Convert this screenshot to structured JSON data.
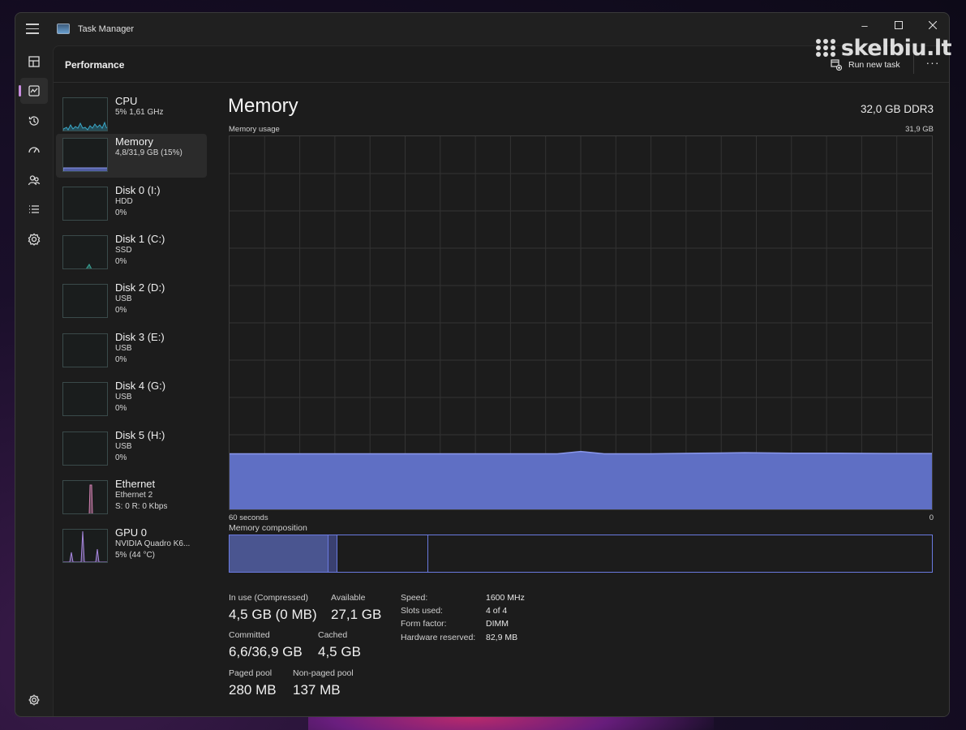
{
  "watermark": "skelbiu.lt",
  "window": {
    "title": "Task Manager"
  },
  "header": {
    "page_title": "Performance",
    "run_new_task": "Run new task",
    "more": "···"
  },
  "nav": [
    {
      "name": "processes",
      "icon": "processes-icon"
    },
    {
      "name": "performance",
      "icon": "performance-icon",
      "active": true
    },
    {
      "name": "app-history",
      "icon": "history-icon"
    },
    {
      "name": "startup-apps",
      "icon": "startup-icon"
    },
    {
      "name": "users",
      "icon": "users-icon"
    },
    {
      "name": "details",
      "icon": "details-icon"
    },
    {
      "name": "services",
      "icon": "services-icon"
    },
    {
      "name": "settings",
      "icon": "gear-icon"
    }
  ],
  "perf_items": [
    {
      "name": "CPU",
      "sub1": "5% 1,61 GHz",
      "sub2": "",
      "kind": "cpu"
    },
    {
      "name": "Memory",
      "sub1": "4,8/31,9 GB (15%)",
      "sub2": "",
      "kind": "memory",
      "selected": true
    },
    {
      "name": "Disk 0 (I:)",
      "sub1": "HDD",
      "sub2": "0%",
      "kind": "disk"
    },
    {
      "name": "Disk 1 (C:)",
      "sub1": "SSD",
      "sub2": "0%",
      "kind": "disk1"
    },
    {
      "name": "Disk 2 (D:)",
      "sub1": "USB",
      "sub2": "0%",
      "kind": "disk"
    },
    {
      "name": "Disk 3 (E:)",
      "sub1": "USB",
      "sub2": "0%",
      "kind": "disk"
    },
    {
      "name": "Disk 4 (G:)",
      "sub1": "USB",
      "sub2": "0%",
      "kind": "disk"
    },
    {
      "name": "Disk 5 (H:)",
      "sub1": "USB",
      "sub2": "0%",
      "kind": "disk"
    },
    {
      "name": "Ethernet",
      "sub1": "Ethernet 2",
      "sub2": "S: 0 R: 0 Kbps",
      "kind": "ethernet"
    },
    {
      "name": "GPU 0",
      "sub1": "NVIDIA Quadro K6...",
      "sub2": "5% (44 °C)",
      "kind": "gpu"
    }
  ],
  "detail": {
    "title": "Memory",
    "spec": "32,0 GB DDR3",
    "usage_label": "Memory usage",
    "usage_max": "31,9 GB",
    "time_left": "60 seconds",
    "time_right": "0",
    "composition_label": "Memory composition",
    "stats": {
      "in_use_label": "In use (Compressed)",
      "in_use": "4,5 GB (0 MB)",
      "available_label": "Available",
      "available": "27,1 GB",
      "committed_label": "Committed",
      "committed": "6,6/36,9 GB",
      "cached_label": "Cached",
      "cached": "4,5 GB",
      "paged_label": "Paged pool",
      "paged": "280 MB",
      "nonpaged_label": "Non-paged pool",
      "nonpaged": "137 MB"
    },
    "specs": {
      "speed_label": "Speed:",
      "speed": "1600 MHz",
      "slots_label": "Slots used:",
      "slots": "4 of 4",
      "form_label": "Form factor:",
      "form": "DIMM",
      "hwres_label": "Hardware reserved:",
      "hwres": "82,9 MB"
    }
  },
  "chart_data": {
    "type": "area",
    "title": "Memory usage",
    "xlabel": "60 seconds",
    "ylabel": "",
    "ylim": [
      0,
      31.9
    ],
    "x": [
      60,
      56,
      52,
      48,
      44,
      40,
      36,
      32,
      30,
      28,
      26,
      24,
      20,
      16,
      12,
      8,
      4,
      0
    ],
    "values": [
      4.75,
      4.75,
      4.75,
      4.75,
      4.75,
      4.75,
      4.75,
      4.75,
      4.95,
      4.75,
      4.75,
      4.75,
      4.8,
      4.85,
      4.8,
      4.8,
      4.78,
      4.78
    ],
    "grid": true,
    "color": "#5f6fc4",
    "line_color": "#8a98ec"
  },
  "composition": [
    {
      "name": "in-use",
      "fraction": 0.141,
      "color": "#4a5590"
    },
    {
      "name": "modified",
      "fraction": 0.013,
      "color": "#3a4070"
    },
    {
      "name": "standby",
      "fraction": 0.129,
      "color": "#1c1c1c"
    },
    {
      "name": "free",
      "fraction": 0.717,
      "color": "#1c1c1c"
    }
  ]
}
